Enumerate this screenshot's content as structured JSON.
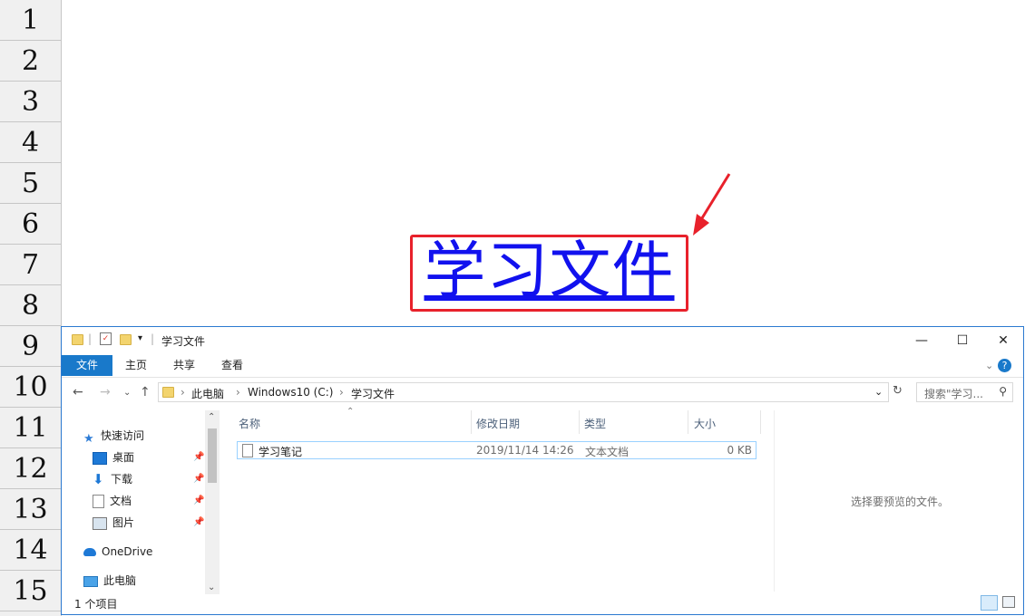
{
  "sheet": {
    "rows": [
      "1",
      "2",
      "3",
      "4",
      "5",
      "6",
      "7",
      "8",
      "9",
      "10",
      "11",
      "12",
      "13",
      "14",
      "15"
    ],
    "link_text": "学习文件",
    "accent_colors": {
      "link": "#1111ee",
      "highlight_box": "#e8212b"
    }
  },
  "window": {
    "title": "学习文件",
    "ribbon_tabs": [
      "文件",
      "主页",
      "共享",
      "查看"
    ],
    "address": {
      "crumbs": [
        "此电脑",
        "Windows10 (C:)",
        "学习文件"
      ]
    },
    "search_placeholder": "搜索\"学习...",
    "nav": {
      "quick_access": "快速访问",
      "items": [
        "桌面",
        "下载",
        "文档",
        "图片"
      ],
      "onedrive": "OneDrive",
      "this_pc": "此电脑"
    },
    "columns": [
      "名称",
      "修改日期",
      "类型",
      "大小"
    ],
    "files": [
      {
        "name": "学习笔记",
        "modified": "2019/11/14 14:26",
        "type": "文本文档",
        "size": "0 KB"
      }
    ],
    "preview_text": "选择要预览的文件。",
    "status_text": "1 个项目"
  }
}
